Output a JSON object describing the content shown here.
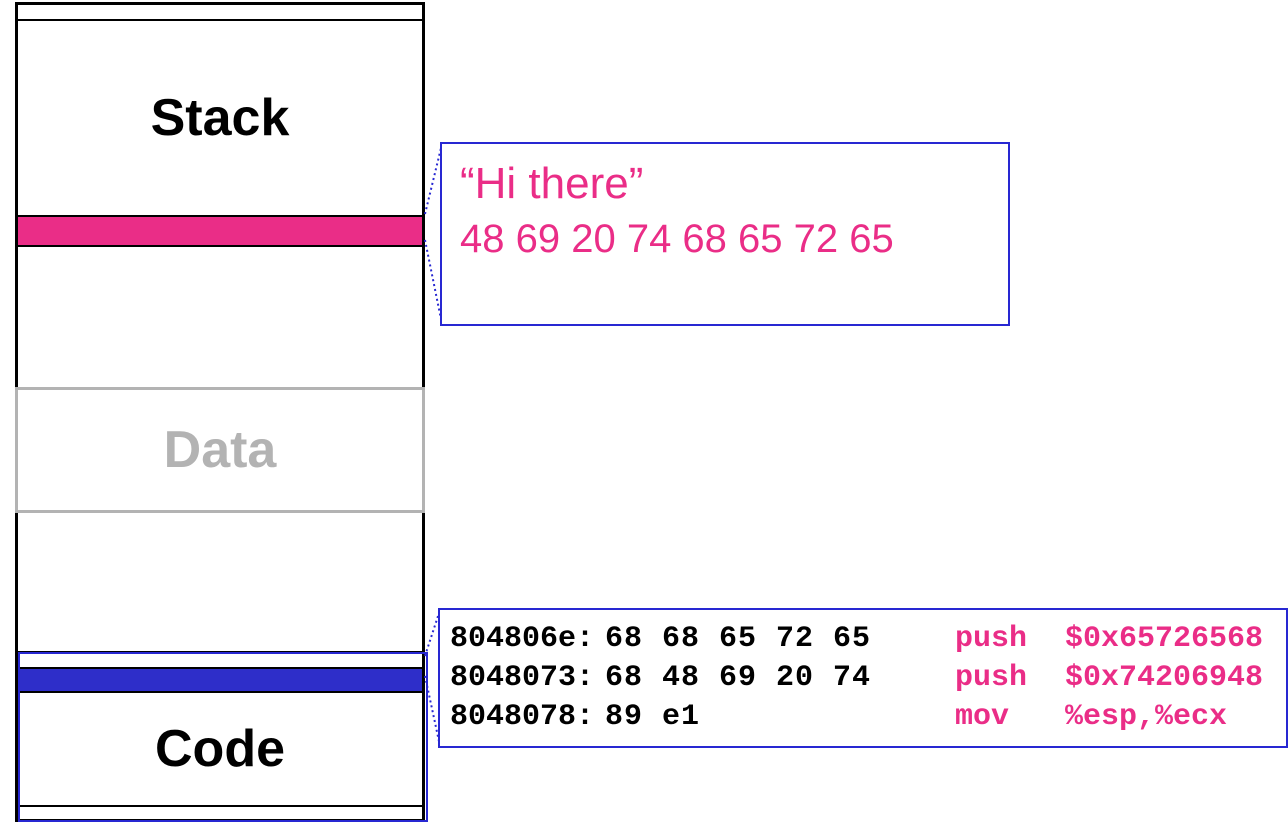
{
  "memory": {
    "stack_label": "Stack",
    "data_label": "Data",
    "code_label": "Code"
  },
  "string_callout": {
    "text": "“Hi there”",
    "hex": "48 69 20 74 68 65 72 65"
  },
  "disasm": {
    "rows": [
      {
        "addr": "804806e:",
        "bytes": "68 68 65 72 65",
        "mnemonic": "push",
        "args": "$0x65726568"
      },
      {
        "addr": "8048073:",
        "bytes": "68 48 69 20 74",
        "mnemonic": "push",
        "args": "$0x74206948"
      },
      {
        "addr": "8048078:",
        "bytes": "89 e1",
        "mnemonic": "mov",
        "args": "%esp,%ecx"
      }
    ]
  },
  "colors": {
    "pink": "#ea2d87",
    "blue_border": "#2828d2",
    "blue_fill": "#2e2ec9",
    "gray": "#b3b3b3"
  }
}
